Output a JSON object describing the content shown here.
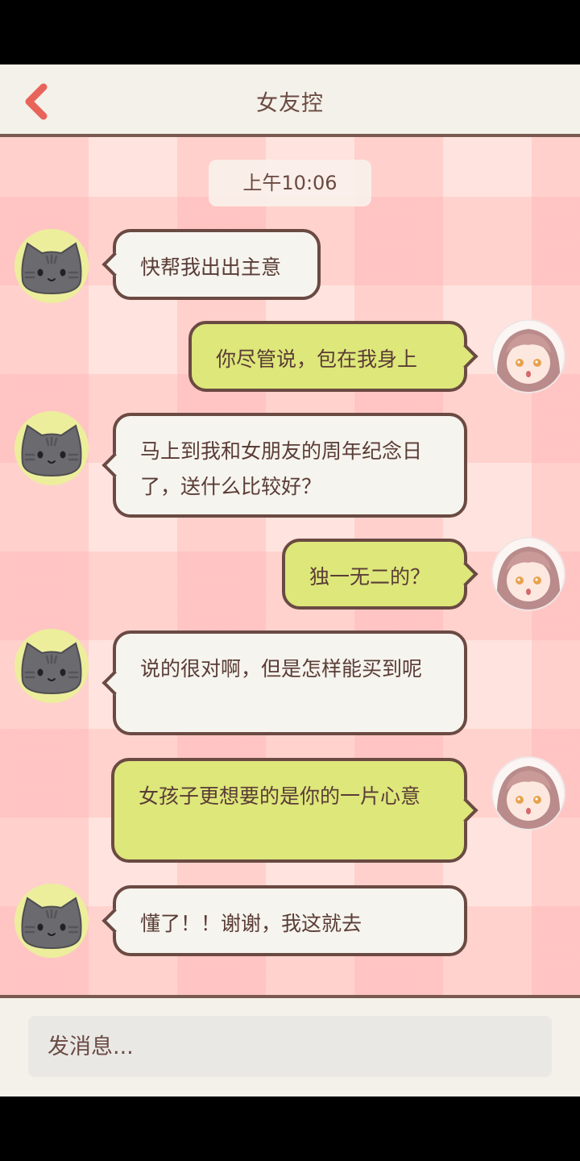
{
  "header": {
    "title": "女友控",
    "back_icon": "back-chevron-icon"
  },
  "chat": {
    "timestamp": "上午10:06",
    "messages": [
      {
        "side": "left",
        "avatar": "cat-avatar",
        "text": "快帮我出出主意"
      },
      {
        "side": "right",
        "avatar": "girl-avatar",
        "text": "你尽管说，包在我身上"
      },
      {
        "side": "left",
        "avatar": "cat-avatar",
        "text": "马上到我和女朋友的周年纪念日了，送什么比较好？"
      },
      {
        "side": "right",
        "avatar": "girl-avatar",
        "text": "独一无二的？"
      },
      {
        "side": "left",
        "avatar": "cat-avatar",
        "text": "说的很对啊，但是怎样能买到呢"
      },
      {
        "side": "right",
        "avatar": "girl-avatar",
        "text": "女孩子更想要的是你的一片心意"
      },
      {
        "side": "left",
        "avatar": "cat-avatar",
        "text": "懂了！！谢谢，我这就去"
      }
    ]
  },
  "input": {
    "placeholder": "发消息..."
  },
  "colors": {
    "accent": "#e8645a",
    "text": "#6a4a42",
    "left_bubble": "#f6f4ee",
    "right_bubble": "#dde77a",
    "cat_bg": "#ecee9c",
    "chat_bg": "#ffe3de"
  }
}
